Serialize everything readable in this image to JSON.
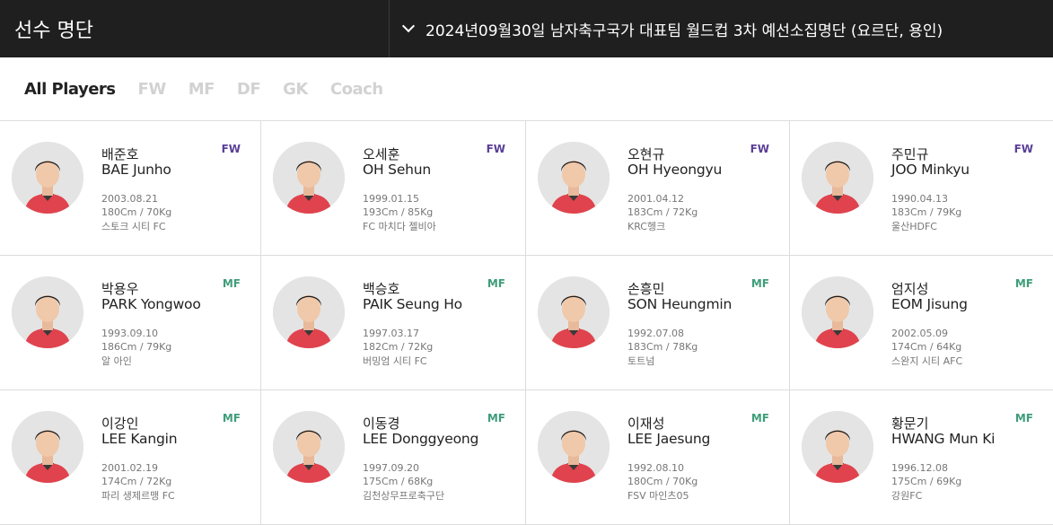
{
  "header": {
    "title": "선수 명단",
    "selected_roster": "2024년09월30일 남자축구국가 대표팀 월드컵 3차 예선소집명단 (요르단, 용인)"
  },
  "tabs": [
    {
      "label": "All Players",
      "active": true
    },
    {
      "label": "FW",
      "active": false
    },
    {
      "label": "MF",
      "active": false
    },
    {
      "label": "DF",
      "active": false
    },
    {
      "label": "GK",
      "active": false
    },
    {
      "label": "Coach",
      "active": false
    }
  ],
  "colors": {
    "header_bg": "#1f1f1f",
    "fw": "#5b3f97",
    "mf": "#3f9d7a",
    "jersey": "#e0434d"
  },
  "players": [
    {
      "name_ko": "배준호",
      "name_en": "BAE Junho",
      "position": "FW",
      "birth": "2003.08.21",
      "body": "180Cm / 70Kg",
      "club": "스토크 시티 FC"
    },
    {
      "name_ko": "오세훈",
      "name_en": "OH Sehun",
      "position": "FW",
      "birth": "1999.01.15",
      "body": "193Cm / 85Kg",
      "club": "FC 마치다 젤비아"
    },
    {
      "name_ko": "오현규",
      "name_en": "OH Hyeongyu",
      "position": "FW",
      "birth": "2001.04.12",
      "body": "183Cm / 72Kg",
      "club": "KRC헹크"
    },
    {
      "name_ko": "주민규",
      "name_en": "JOO Minkyu",
      "position": "FW",
      "birth": "1990.04.13",
      "body": "183Cm / 79Kg",
      "club": "울산HDFC"
    },
    {
      "name_ko": "박용우",
      "name_en": "PARK Yongwoo",
      "position": "MF",
      "birth": "1993.09.10",
      "body": "186Cm / 79Kg",
      "club": "알 아인"
    },
    {
      "name_ko": "백승호",
      "name_en": "PAIK Seung Ho",
      "position": "MF",
      "birth": "1997.03.17",
      "body": "182Cm / 72Kg",
      "club": "버밍엄 시티 FC"
    },
    {
      "name_ko": "손흥민",
      "name_en": "SON Heungmin",
      "position": "MF",
      "birth": "1992.07.08",
      "body": "183Cm / 78Kg",
      "club": "토트넘"
    },
    {
      "name_ko": "엄지성",
      "name_en": "EOM Jisung",
      "position": "MF",
      "birth": "2002.05.09",
      "body": "174Cm / 64Kg",
      "club": "스완지 시티 AFC"
    },
    {
      "name_ko": "이강인",
      "name_en": "LEE Kangin",
      "position": "MF",
      "birth": "2001.02.19",
      "body": "174Cm / 72Kg",
      "club": "파리 생제르맹 FC"
    },
    {
      "name_ko": "이동경",
      "name_en": "LEE Donggyeong",
      "position": "MF",
      "birth": "1997.09.20",
      "body": "175Cm / 68Kg",
      "club": "김천상무프로축구단"
    },
    {
      "name_ko": "이재성",
      "name_en": "LEE Jaesung",
      "position": "MF",
      "birth": "1992.08.10",
      "body": "180Cm / 70Kg",
      "club": "FSV 마인츠05"
    },
    {
      "name_ko": "황문기",
      "name_en": "HWANG Mun Ki",
      "position": "MF",
      "birth": "1996.12.08",
      "body": "175Cm / 69Kg",
      "club": "강원FC"
    }
  ]
}
